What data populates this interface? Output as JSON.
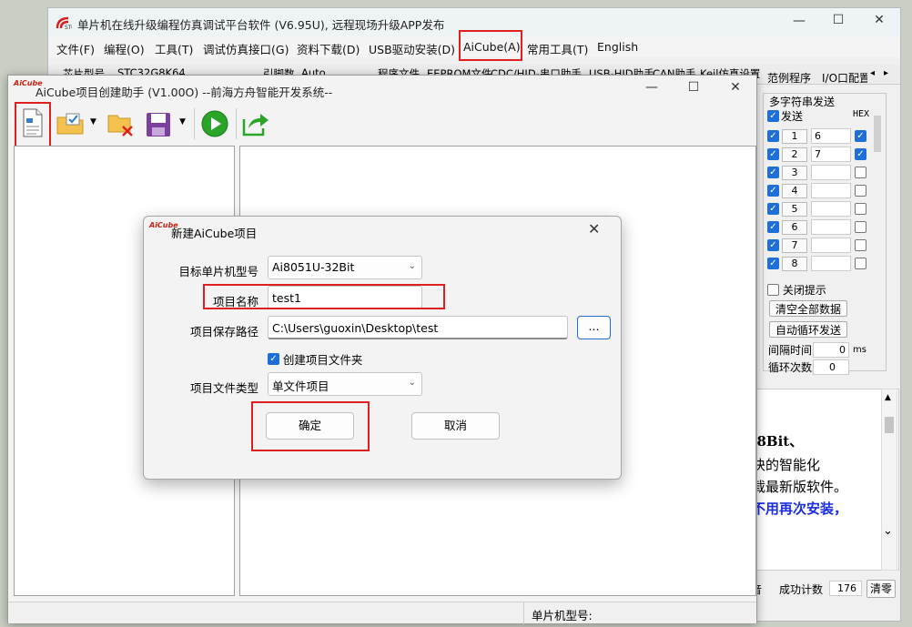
{
  "main_window": {
    "title": "单片机在线升级编程仿真调试平台软件 (V6.95U), 远程现场升级APP发布",
    "menu": [
      "文件(F)",
      "编程(O)",
      "工具(T)",
      "调试仿真接口(G)",
      "资料下载(D)",
      "USB驱动安装(D)",
      "AiCube(A)",
      "常用工具(T)",
      "English"
    ],
    "toolrow": [
      "芯片型号",
      "STC32G8K64",
      "引脚数",
      "Auto",
      "程序文件",
      "EEPROM文件",
      "CDC/HID-串口助手",
      "USB-HID助手",
      "CAN助手",
      "Keil仿真设置",
      "范例程序",
      "I/O口配置"
    ],
    "multi_send": {
      "title": "多字符串发送",
      "send_label": "发送",
      "hex_label": "HEX",
      "rows": [
        {
          "n": "1",
          "value": "6",
          "hex": true
        },
        {
          "n": "2",
          "value": "7",
          "hex": true
        },
        {
          "n": "3",
          "value": "",
          "hex": false
        },
        {
          "n": "4",
          "value": "",
          "hex": false
        },
        {
          "n": "5",
          "value": "",
          "hex": false
        },
        {
          "n": "6",
          "value": "",
          "hex": false
        },
        {
          "n": "7",
          "value": "",
          "hex": false
        },
        {
          "n": "8",
          "value": "",
          "hex": false
        }
      ],
      "close_tip": "关闭提示",
      "clear_all": "清空全部数据",
      "auto_loop": "自动循环发送",
      "interval_label": "间隔时间",
      "interval_value": "0",
      "interval_unit": "ms",
      "loop_label": "循环次数",
      "loop_value": "0"
    },
    "log_lines": [
      "/8Bit、",
      "块的智能化",
      "载最新版软件。",
      "不用再次安装，"
    ],
    "status": {
      "sound": "音",
      "success_label": "成功计数",
      "success_value": "176",
      "clear": "清零"
    }
  },
  "aicube": {
    "logo": "AiCube",
    "title": "AiCube项目创建助手 (V1.00O) --前海方舟智能开发系统--",
    "status_label": "单片机型号:"
  },
  "dialog": {
    "title": "新建AiCube项目",
    "target_label": "目标单片机型号",
    "target_value": "Ai8051U-32Bit",
    "name_label": "项目名称",
    "name_value": "test1",
    "path_label": "项目保存路径",
    "path_value": "C:\\Users\\guoxin\\Desktop\\test",
    "browse": "...",
    "create_folder": "创建项目文件夹",
    "type_label": "项目文件类型",
    "type_value": "单文件项目",
    "ok": "确定",
    "cancel": "取消"
  },
  "colors": {
    "highlight": "#e02020",
    "check": "#1e6fd9",
    "blue_text": "#1b2ee0"
  }
}
